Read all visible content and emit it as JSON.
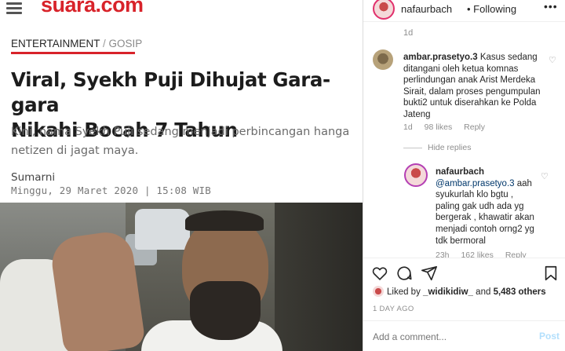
{
  "article": {
    "site_logo": "suara.com",
    "category": "ENTERTAINMENT",
    "separator": " / ",
    "subcategory": "GOSIP",
    "headline_line1": "Viral, Syekh Puji Dihujat Gara-gara",
    "headline_line2": "Nikahi Bocah 7 Tahun",
    "lede_line1": "Kini, nama Syekh Puji sedang menjadi perbincangan hanga",
    "lede_line2": "netizen di jagat maya.",
    "author": "Sumarni",
    "dateline": "Minggu, 29 Maret 2020 | 15:08 WIB"
  },
  "post": {
    "username": "nafaurbach",
    "follow_status": "• Following",
    "more": "•••",
    "cut_text": "1d",
    "comments": [
      {
        "username": "ambar.prasetyo.3",
        "text": "Kasus sedang ditangani oleh ketua komnas perlindungan anak Arist Merdeka Sirait, dalam proses pengumpulan bukti2 untuk diserahkan ke Polda Jateng",
        "age": "1d",
        "likes": "98 likes",
        "reply": "Reply"
      }
    ],
    "hide_replies": "Hide replies",
    "reply": {
      "username": "nafaurbach",
      "mention": "@ambar.prasetyo.3",
      "text": "aah syukurlah klo bgtu , paling gak udh ada yg bergerak , khawatir akan menjadi contoh orng2 yg tdk bermoral",
      "age": "23h",
      "likes": "162 likes",
      "reply_label": "Reply"
    },
    "likes": {
      "prefix": "Liked by",
      "user": "_widikidiw_",
      "and": "and",
      "others": "5,483 others"
    },
    "time_ago": "1 DAY AGO",
    "add_comment_placeholder": "Add a comment...",
    "post_label": "Post"
  },
  "colors": {
    "brand_red": "#d8232a",
    "ig_link": "#00376b",
    "muted": "#8e8e8e",
    "post_disabled": "#b2dffc"
  }
}
